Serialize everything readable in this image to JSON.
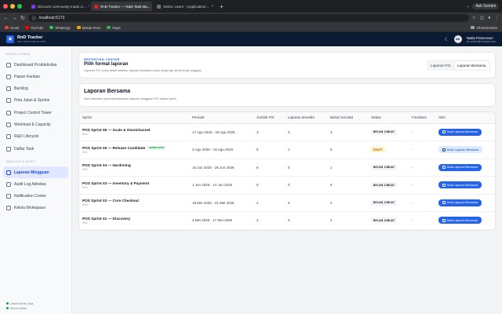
{
  "browser": {
    "tabs": [
      {
        "title": "Discover community-made Li..."
      },
      {
        "title": "RnD Tracker — R&D Task Ma..."
      },
      {
        "title": "Select: users - /Application/..."
      }
    ],
    "gemini_label": "Ask Gemini",
    "url": "localhost:5173",
    "bookmarks": [
      "Gmail",
      "YouTube",
      "WhatsApp",
      "Masak Terus",
      "Maps"
    ],
    "all_bookmarks": "All Bookmarks",
    "colors": {
      "gmail": "#ea4335",
      "youtube": "#ff0000",
      "whatsapp": "#25d366",
      "masak": "#f59e0b",
      "maps": "#34a853"
    }
  },
  "app": {
    "brand": "RnD Tracker",
    "brand_sub": "R&D WORKSPACE PRO",
    "user_initials": "NA",
    "user_name": "Nadia Pramesvari",
    "user_email": "pm.admin@example.com"
  },
  "sidebar": {
    "section1": "MODUL UTAMA",
    "items1": [
      {
        "label": "Dashboard Produktivitas",
        "icon": "dashboard-icon"
      },
      {
        "label": "Papan Kanban",
        "icon": "kanban-icon"
      },
      {
        "label": "Backlog",
        "icon": "backlog-icon"
      },
      {
        "label": "Peta Jalan & Sprints",
        "icon": "roadmap-icon"
      },
      {
        "label": "Project Control Tower",
        "icon": "tower-icon"
      },
      {
        "label": "Workload & Capacity",
        "icon": "workload-icon"
      },
      {
        "label": "R&D Lifecycle",
        "icon": "lifecycle-icon"
      },
      {
        "label": "Daftar Task",
        "icon": "task-list-icon"
      }
    ],
    "section2": "ANALISIS & AUDIT",
    "items2": [
      {
        "label": "Laporan Mingguan",
        "icon": "report-icon",
        "active": true
      },
      {
        "label": "Audit Log Aktivitas",
        "icon": "audit-icon"
      },
      {
        "label": "Notification Center",
        "icon": "bell-icon"
      },
      {
        "label": "Kelola Workspace",
        "icon": "workspace-icon"
      }
    ],
    "footer_line1": "Linked Server: Asia",
    "footer_line2": "Server Online"
  },
  "report_center": {
    "label": "REPORTING CENTER",
    "title": "Pilih format laporan",
    "desc": "Laporan PIC untuk detail individu, laporan bersama untuk rekap tiap sprint lintas anggota.",
    "seg_pic": "Laporan PIC",
    "seg_bersama": "Laporan Bersama"
  },
  "laporan": {
    "title": "Laporan Bersama",
    "desc": "Satu dokumen sprint berdasarkan laporan mingguan PIC dalam sprint."
  },
  "table": {
    "headers": [
      "Sprint",
      "Periode",
      "Jumlah PIC",
      "Laporan tersedia",
      "Belum tercatat",
      "Status",
      "Finalisasi",
      "Aksi"
    ],
    "rows": [
      {
        "sprint": "POS Sprint 06 — Scale & Omnichannel",
        "sub": "RnD",
        "tag": "",
        "periode": "17 Agu 2026 - 30 Agu 2026",
        "pic": "3",
        "tersedia": "0",
        "belum": "3",
        "status": "BELUM_DIBUAT",
        "final": "-",
        "aksi": "Buat Laporan Bersama",
        "kind": "bd"
      },
      {
        "sprint": "POS Sprint 05 — Release Candidate",
        "sub": "RnD",
        "tag": "SPRINT AKTIF",
        "periode": "3 Agu 2026 - 16 Agu 2026",
        "pic": "6",
        "tersedia": "1",
        "belum": "5",
        "status": "DRAFT",
        "final": "-",
        "aksi": "Buka Laporan Bersama",
        "kind": "dr"
      },
      {
        "sprint": "POS Sprint 04 — Hardening",
        "sub": "RnD",
        "tag": "",
        "periode": "15 Jun 2026 - 28 Jun 2026",
        "pic": "6",
        "tersedia": "5",
        "belum": "1",
        "status": "BELUM_DIBUAT",
        "final": "-",
        "aksi": "Buat Laporan Bersama",
        "kind": "bd"
      },
      {
        "sprint": "POS Sprint 03 — Inventory & Payment",
        "sub": "RnD",
        "tag": "",
        "periode": "1 Jun 2026 - 14 Jun 2026",
        "pic": "5",
        "tersedia": "0",
        "belum": "5",
        "status": "BELUM_DIBUAT",
        "final": "-",
        "aksi": "Buat Laporan Bersama",
        "kind": "bd"
      },
      {
        "sprint": "POS Sprint 02 — Core Checkout",
        "sub": "RnD",
        "tag": "",
        "periode": "18 Mei 2026 - 31 Mei 2026",
        "pic": "2",
        "tersedia": "0",
        "belum": "2",
        "status": "BELUM_DIBUAT",
        "final": "-",
        "aksi": "Buat Laporan Bersama",
        "kind": "bd"
      },
      {
        "sprint": "POS Sprint 01 — Discovery",
        "sub": "RnD",
        "tag": "",
        "periode": "4 Mei 2026 - 17 Mei 2026",
        "pic": "2",
        "tersedia": "0",
        "belum": "2",
        "status": "BELUM_DIBUAT",
        "final": "-",
        "aksi": "Buat Laporan Bersama",
        "kind": "bd"
      }
    ]
  }
}
